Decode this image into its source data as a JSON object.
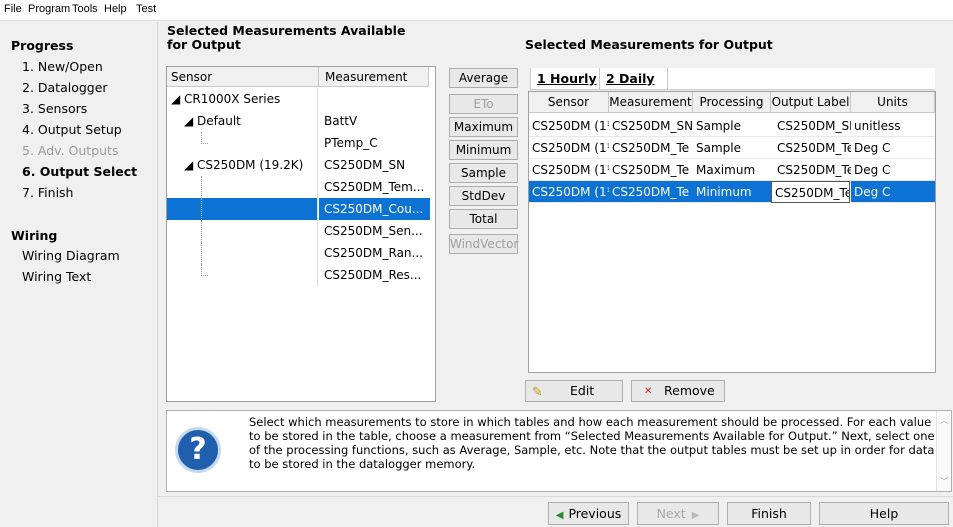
{
  "menu": [
    "File",
    "Program",
    "Tools",
    "Help",
    "Test"
  ],
  "sidebar": {
    "progress_title": "Progress",
    "steps": [
      {
        "label": "1. New/Open",
        "state": "normal"
      },
      {
        "label": "2. Datalogger",
        "state": "normal"
      },
      {
        "label": "3. Sensors",
        "state": "normal"
      },
      {
        "label": "4. Output Setup",
        "state": "normal"
      },
      {
        "label": "5. Adv. Outputs",
        "state": "disabled"
      },
      {
        "label": "6. Output Select",
        "state": "current"
      },
      {
        "label": "7. Finish",
        "state": "normal"
      }
    ],
    "wiring_title": "Wiring",
    "wiring_items": [
      "Wiring Diagram",
      "Wiring Text"
    ]
  },
  "available": {
    "title": "Selected Measurements Available for Output",
    "headers": [
      "Sensor",
      "Measurement"
    ],
    "rows": [
      {
        "sensor": "◢ CR1000X Series",
        "measurement": ""
      },
      {
        "sensor": "◢ Default",
        "measurement": "BattV"
      },
      {
        "sensor": "",
        "measurement": "PTemp_C"
      },
      {
        "sensor": "◢ CS250DM (19.2K)",
        "measurement": "CS250DM_SN"
      },
      {
        "sensor": "",
        "measurement": "CS250DM_Tem..."
      },
      {
        "sensor": "",
        "measurement": "CS250DM_Cou..."
      },
      {
        "sensor": "",
        "measurement": "CS250DM_Sen..."
      },
      {
        "sensor": "",
        "measurement": "CS250DM_Ran..."
      },
      {
        "sensor": "",
        "measurement": "CS250DM_Res..."
      }
    ]
  },
  "processing_buttons": [
    {
      "label": "Average",
      "enabled": true
    },
    {
      "label": "ETo",
      "enabled": false
    },
    {
      "label": "Maximum",
      "enabled": true
    },
    {
      "label": "Minimum",
      "enabled": true
    },
    {
      "label": "Sample",
      "enabled": true
    },
    {
      "label": "StdDev",
      "enabled": true
    },
    {
      "label": "Total",
      "enabled": true
    },
    {
      "label": "WindVector",
      "enabled": false
    }
  ],
  "output": {
    "title": "Selected Measurements for Output",
    "tabs": [
      "1 Hourly",
      "2 Daily"
    ],
    "headers": [
      "Sensor",
      "Measurement",
      "Processing",
      "Output Label",
      "Units"
    ],
    "rows": [
      [
        "CS250DM (1¹",
        "CS250DM_SN",
        "Sample",
        "CS250DM_SN",
        "unitless"
      ],
      [
        "CS250DM (1¹",
        "CS250DM_Te",
        "Sample",
        "CS250DM_Te",
        "Deg C"
      ],
      [
        "CS250DM (1¹",
        "CS250DM_Te",
        "Maximum",
        "CS250DM_Te",
        "Deg C"
      ],
      [
        "CS250DM (1¹",
        "CS250DM_Te",
        "Minimum",
        "CS250DM_Te",
        "Deg C"
      ]
    ],
    "edit_label": "Edit",
    "remove_label": "Remove"
  },
  "help_text": "Select which measurements to store in which tables and how each measurement should be processed. For each value to be stored in the table, choose a measurement from “Selected Measurements Available for Output.”  Next, select one of the processing functions, such as Average, Sample, etc. Note that the output tables must be set up in order for data to be stored in the datalogger memory.",
  "nav": {
    "previous": "Previous",
    "next": "Next",
    "finish": "Finish",
    "help": "Help"
  },
  "colors": {
    "selection": "#0c73d4",
    "help_icon": "#1f5fae"
  }
}
